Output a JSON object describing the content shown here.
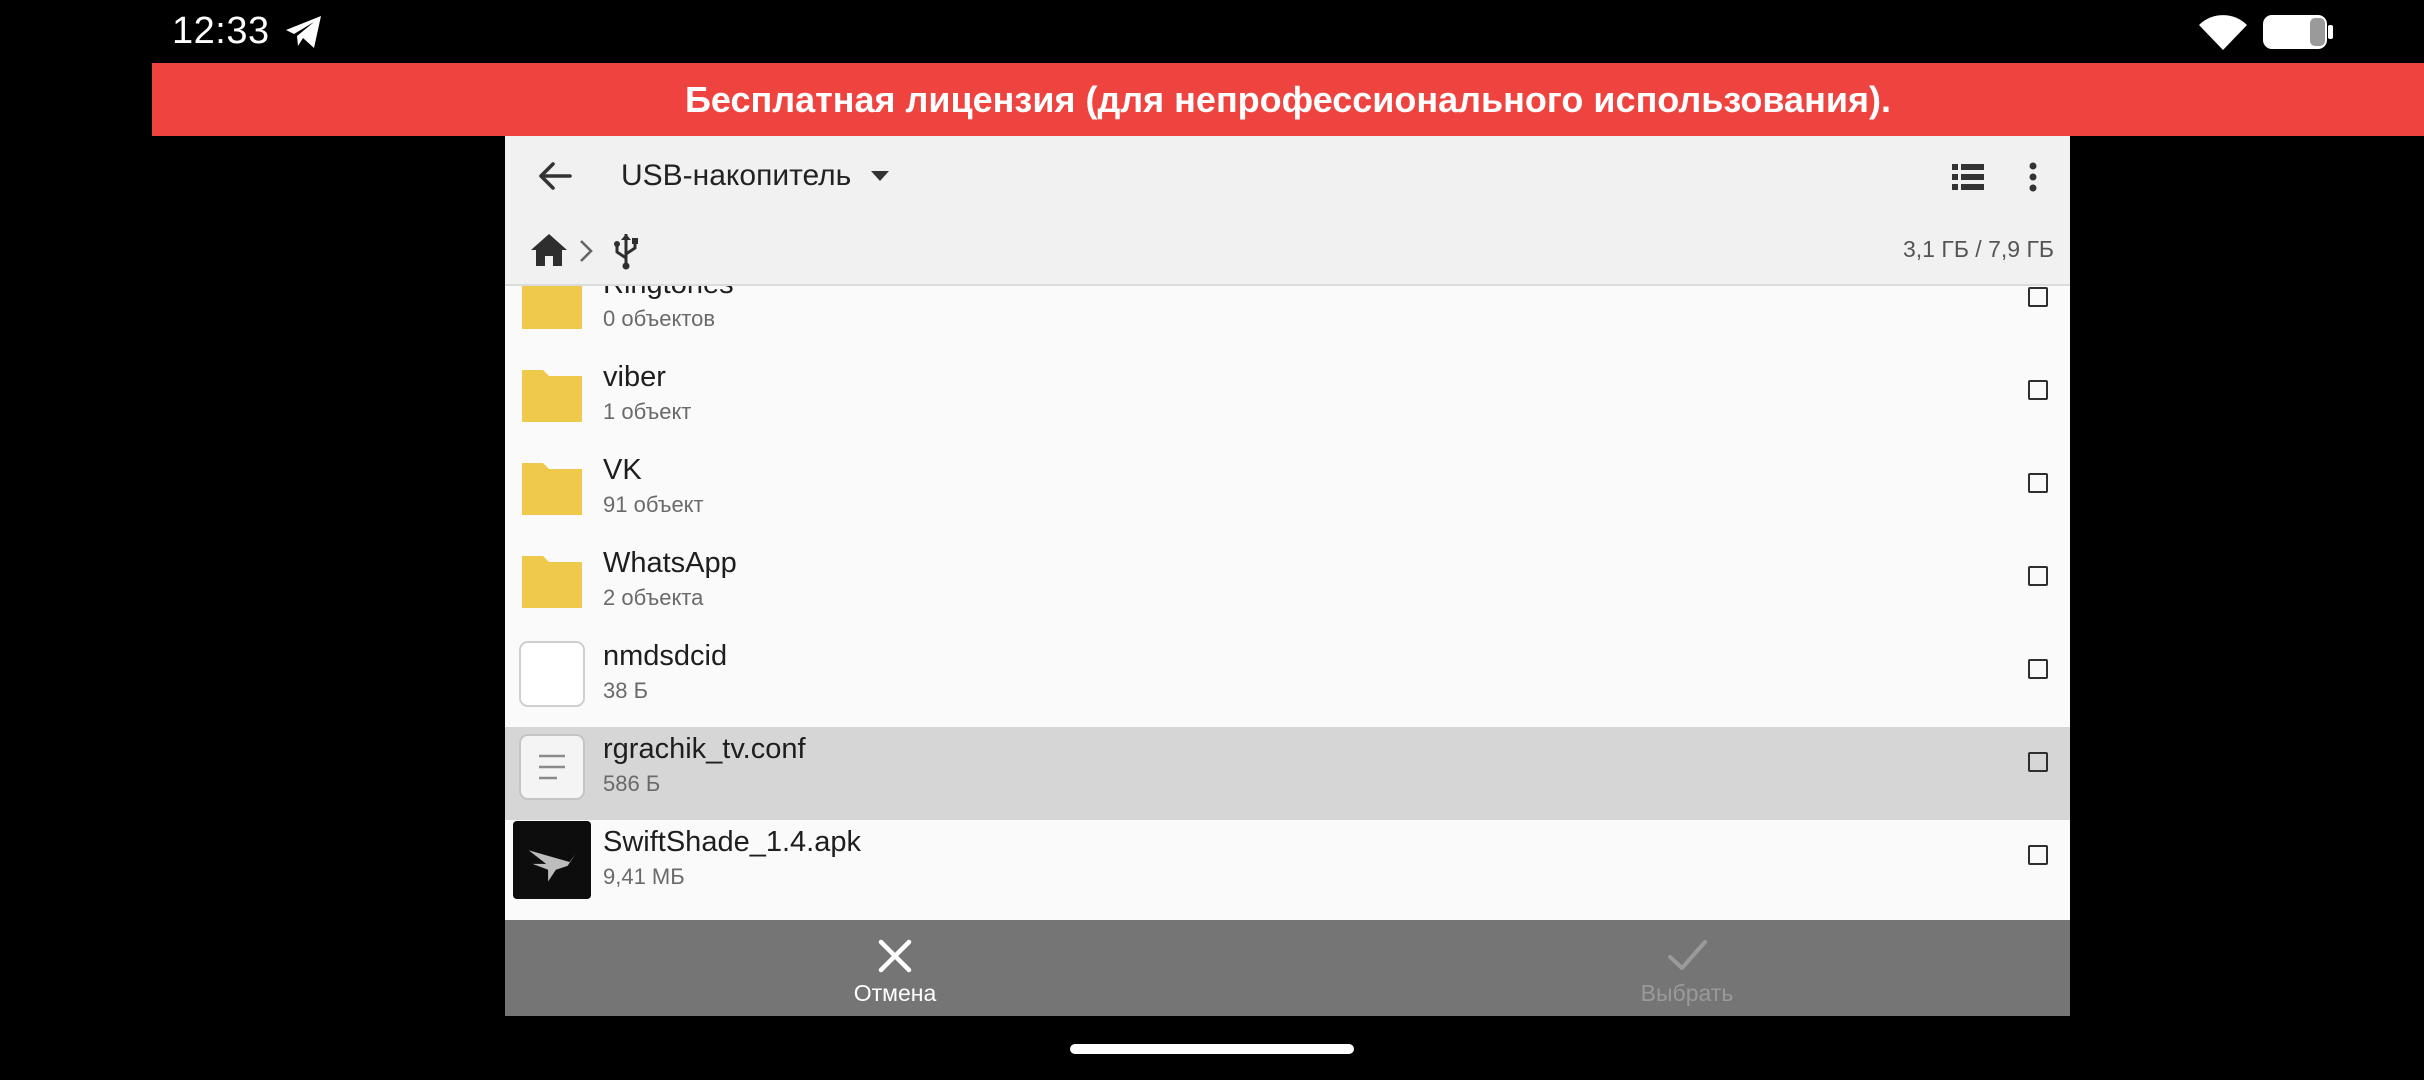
{
  "status_bar": {
    "time": "12:33",
    "icons": [
      "telegram-icon",
      "wifi-icon",
      "battery-icon"
    ]
  },
  "banner": {
    "text": "Бесплатная лицензия (для непрофессионального использования).",
    "color": "#ef4340"
  },
  "toolbar": {
    "location": "USB-накопитель",
    "icons": [
      "back-arrow-icon",
      "dropdown-caret-icon",
      "list-view-icon",
      "more-vert-icon"
    ]
  },
  "pathbar": {
    "crumbs": [
      "home-icon",
      "usb-icon"
    ],
    "storage": "3,1 ГБ / 7,9 ГБ"
  },
  "files": [
    {
      "name": "Ringtones",
      "meta": "0 объектов",
      "icon": "folder-icon",
      "selected": false
    },
    {
      "name": "viber",
      "meta": "1 объект",
      "icon": "folder-icon",
      "selected": false
    },
    {
      "name": "VK",
      "meta": "91 объект",
      "icon": "folder-icon",
      "selected": false
    },
    {
      "name": "WhatsApp",
      "meta": "2 объекта",
      "icon": "folder-icon",
      "selected": false
    },
    {
      "name": "nmdsdcid",
      "meta": "38 Б",
      "icon": "blank-file-icon",
      "selected": false
    },
    {
      "name": "rgrachik_tv.conf",
      "meta": "586 Б",
      "icon": "text-file-icon",
      "selected": true
    },
    {
      "name": "SwiftShade_1.4.apk",
      "meta": "9,41 МБ",
      "icon": "apk-icon",
      "selected": false
    }
  ],
  "actions": {
    "cancel_label": "Отмена",
    "select_label": "Выбрать"
  },
  "colors": {
    "folder": "#efc94c",
    "action_bar": "#757575",
    "selected_row": "#d6d6d6"
  }
}
